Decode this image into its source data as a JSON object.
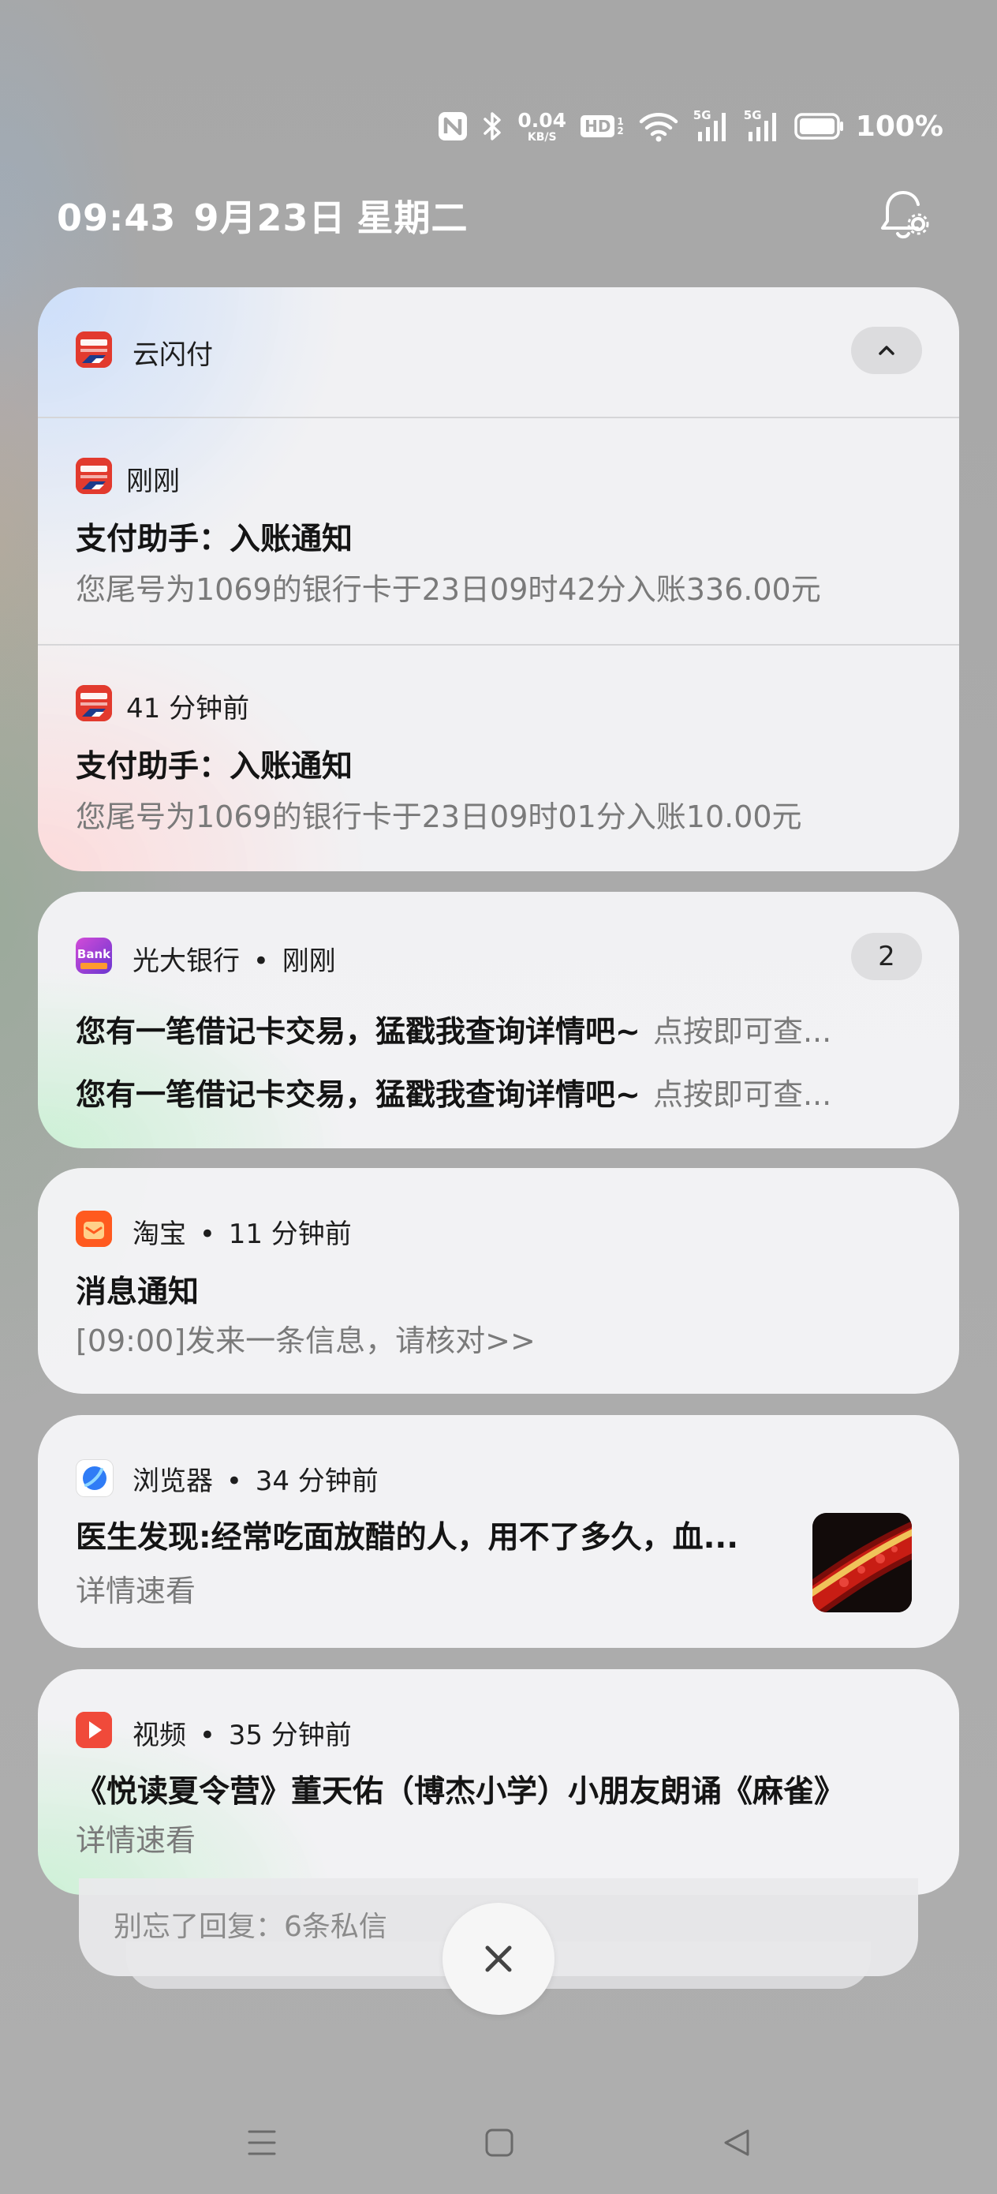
{
  "status_bar": {
    "net_speed_value": "0.04",
    "net_speed_unit": "KB/S",
    "hd_label": "HD",
    "signal1_label": "5G",
    "signal2_label": "5G",
    "battery_text": "100%"
  },
  "header": {
    "time": "09:43",
    "date": "9月23日",
    "weekday": "星期二"
  },
  "notifications": {
    "yunshanfu": {
      "app_name": "云闪付",
      "items": [
        {
          "time": "刚刚",
          "title": "支付助手：入账通知",
          "body": "您尾号为1069的银行卡于23日09时42分入账336.00元"
        },
        {
          "time": "41 分钟前",
          "title": "支付助手：入账通知",
          "body": "您尾号为1069的银行卡于23日09时01分入账10.00元"
        }
      ]
    },
    "guangda": {
      "app_name": "光大银行",
      "time": "刚刚",
      "count": "2",
      "lines": [
        {
          "text": "您有一笔借记卡交易，猛戳我查询详情吧~",
          "hint": "点按即可查..."
        },
        {
          "text": "您有一笔借记卡交易，猛戳我查询详情吧~",
          "hint": "点按即可查..."
        }
      ]
    },
    "taobao": {
      "app_name": "淘宝",
      "time": "11 分钟前",
      "title": "消息通知",
      "body": "[09:00]发来一条信息，请核对>>"
    },
    "browser": {
      "app_name": "浏览器",
      "time": "34 分钟前",
      "title": "医生发现:经常吃面放醋的人，用不了多久，血...",
      "body": "详情速看"
    },
    "video": {
      "app_name": "视频",
      "time": "35 分钟前",
      "title": "《悦读夏令营》董天佑（博杰小学）小朋友朗诵《麻雀》",
      "body": "详情速看"
    },
    "stacked": {
      "text": "别忘了回复：6条私信"
    }
  },
  "separator": "•",
  "colors": {
    "yunshanfu_red": "#e23a2e",
    "guangda_purple": "#7a3cc9",
    "taobao_orange": "#ff5a1f",
    "browser_blue": "#2f7cf6",
    "video_red": "#f04a3a"
  }
}
